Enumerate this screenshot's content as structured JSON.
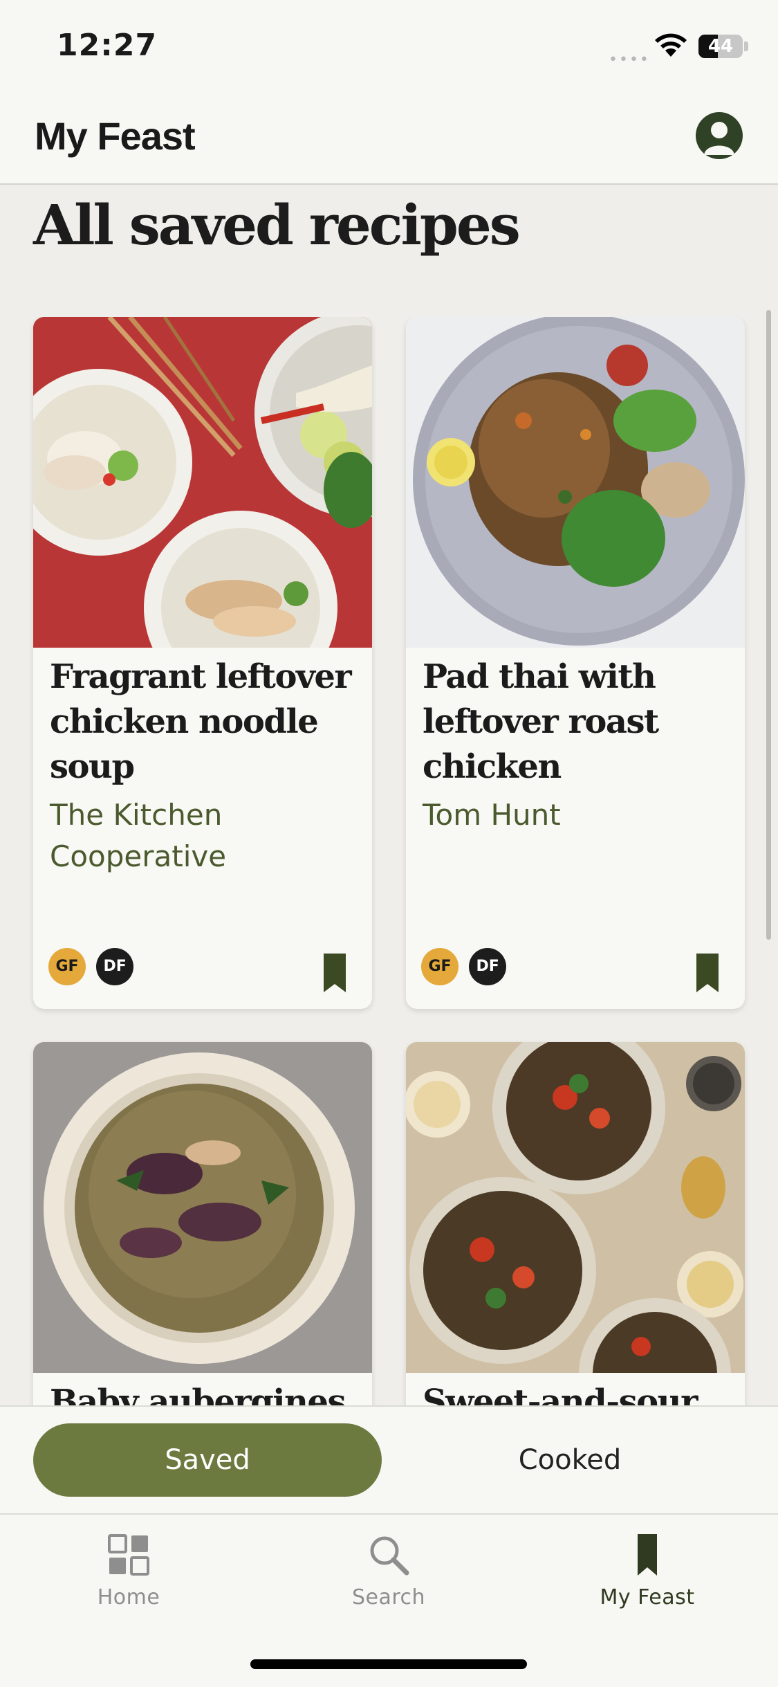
{
  "status_bar": {
    "time": "12:27",
    "signal": "••••",
    "battery": "44",
    "battery_level": 0.44
  },
  "header": {
    "title": "My Feast"
  },
  "page": {
    "title": "All saved recipes"
  },
  "recipes": [
    {
      "title": "Fragrant leftover chicken noodle soup",
      "author": "The Kitchen Cooperative",
      "badges": [
        "GF",
        "DF"
      ]
    },
    {
      "title": "Pad thai with leftover roast chicken",
      "author": "Tom Hunt",
      "badges": [
        "GF",
        "DF"
      ]
    },
    {
      "title": "Baby aubergines"
    },
    {
      "title": "Sweet-and-sour"
    }
  ],
  "segments": {
    "saved": "Saved",
    "cooked": "Cooked"
  },
  "tabs": [
    {
      "label": "Home"
    },
    {
      "label": "Search"
    },
    {
      "label": "My Feast"
    }
  ],
  "colors": {
    "accent": "#6d7a3f",
    "dark_green": "#304225",
    "gf_badge": "#e4a93a",
    "df_badge": "#1d1d1d",
    "author": "#4b5a2e"
  }
}
